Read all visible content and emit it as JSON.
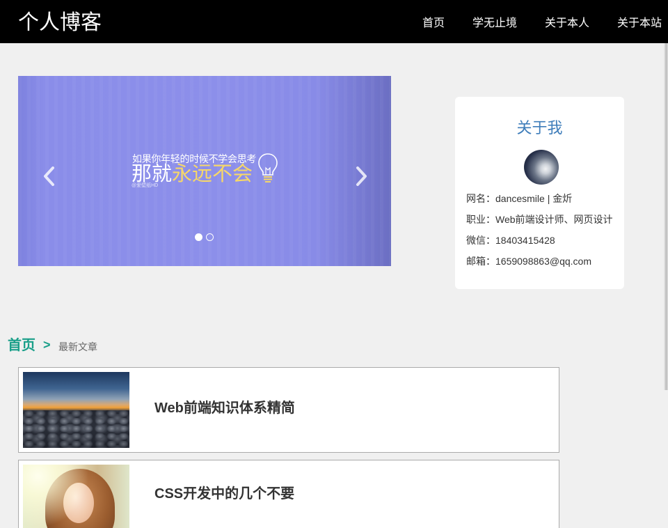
{
  "header": {
    "logo": "个人博客",
    "nav": [
      "首页",
      "学无止境",
      "关于本人",
      "关于本站"
    ]
  },
  "banner": {
    "line1": "如果你年轻的时候不学会思考",
    "line2_plain": "那就",
    "line2_highlight": "永远不会",
    "watermark": "@爱壁纸HD",
    "slides": 2,
    "active_slide": 1,
    "icons": {
      "prev": "chevron-left-icon",
      "next": "chevron-right-icon",
      "bulb": "light-bulb-icon"
    }
  },
  "about": {
    "title": "关于我",
    "rows": [
      {
        "label": "网名：",
        "value": "dancesmile | 金炘"
      },
      {
        "label": "职业：",
        "value": "Web前端设计师、网页设计"
      },
      {
        "label": "微信：",
        "value": "18403415428"
      },
      {
        "label": "邮箱：",
        "value": "1659098863@qq.com"
      }
    ]
  },
  "breadcrumb": {
    "home": "首页",
    "separator": ">",
    "current": "最新文章"
  },
  "articles": [
    {
      "title": "Web前端知识体系精简"
    },
    {
      "title": "CSS开发中的几个不要"
    }
  ],
  "colors": {
    "header_bg": "#000000",
    "page_bg": "#f0f0f0",
    "accent": "#1a9f89",
    "about_title": "#3e7dba",
    "banner_bg": "#8b8eea",
    "banner_highlight": "#f6d769"
  }
}
